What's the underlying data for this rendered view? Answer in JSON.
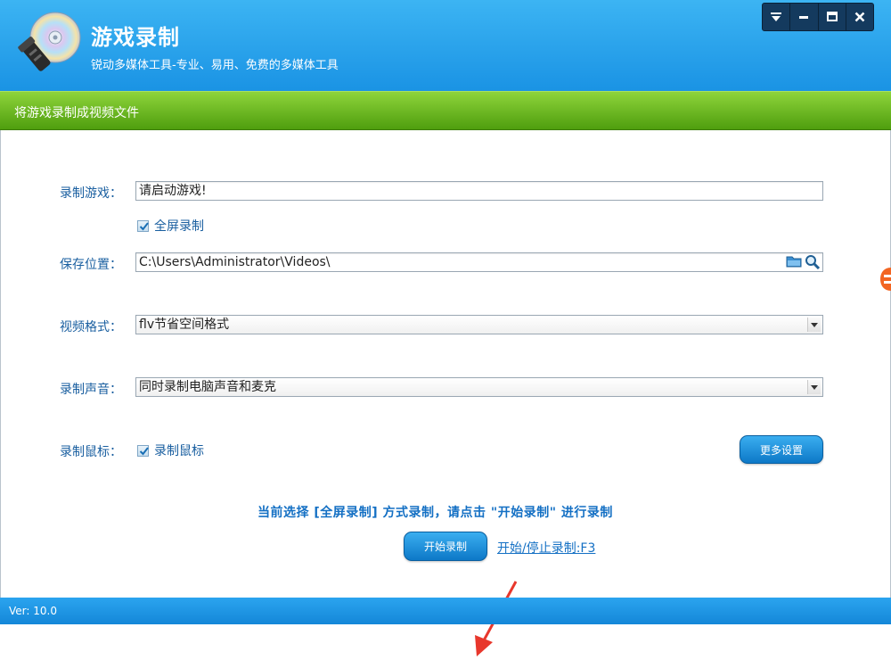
{
  "app": {
    "title": "游戏录制",
    "subtitle": "锐动多媒体工具-专业、易用、免费的多媒体工具"
  },
  "window_controls": [
    "menu-icon",
    "minimize-icon",
    "maximize-icon",
    "close-icon"
  ],
  "banner": {
    "text": "将游戏录制成视频文件"
  },
  "form": {
    "game": {
      "label": "录制游戏：",
      "value": "请启动游戏!"
    },
    "fullscreen": {
      "label": "全屏录制",
      "checked": true
    },
    "save_location": {
      "label": "保存位置：",
      "value": "C:\\Users\\Administrator\\Videos\\"
    },
    "video_format": {
      "label": "视频格式：",
      "value": "flv节省空间格式"
    },
    "audio": {
      "label": "录制声音：",
      "value": "同时录制电脑声音和麦克"
    },
    "mouse": {
      "label": "录制鼠标：",
      "checkbox_label": "录制鼠标",
      "checked": true
    }
  },
  "more_settings_button": "更多设置",
  "hint": "当前选择 [全屏录制] 方式录制，请点击 \"开始录制\" 进行录制",
  "start_button": "开始录制",
  "hotkey_link": "开始/停止录制:F3",
  "footer": {
    "version": "Ver: 10.0"
  },
  "colors": {
    "header": "#1a93e4",
    "banner": "#6ab822",
    "label": "#1a5fa0",
    "accent": "#1470c4"
  }
}
